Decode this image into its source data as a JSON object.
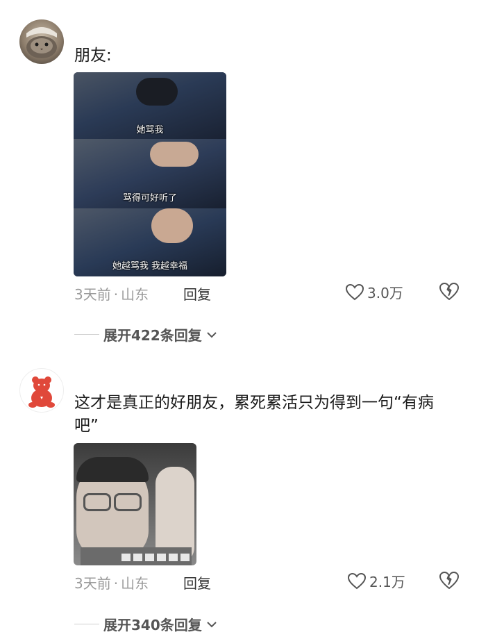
{
  "comments": [
    {
      "text": "朋友:",
      "image_captions": [
        "她骂我",
        "骂得可好听了",
        "她越骂我 我越幸福"
      ],
      "time": "3天前",
      "separator": "·",
      "location": "山东",
      "reply_label": "回复",
      "likes": "3.0万",
      "expand_label": "展开422条回复"
    },
    {
      "text": "这才是真正的好朋友，累死累活只为得到一句“有病吧”",
      "image_captions": [],
      "time": "3天前",
      "separator": "·",
      "location": "山东",
      "reply_label": "回复",
      "likes": "2.1万",
      "expand_label": "展开340条回复"
    }
  ],
  "icons": {
    "like": "heart-outline-icon",
    "dislike": "broken-heart-icon",
    "expand": "chevron-down-icon"
  }
}
